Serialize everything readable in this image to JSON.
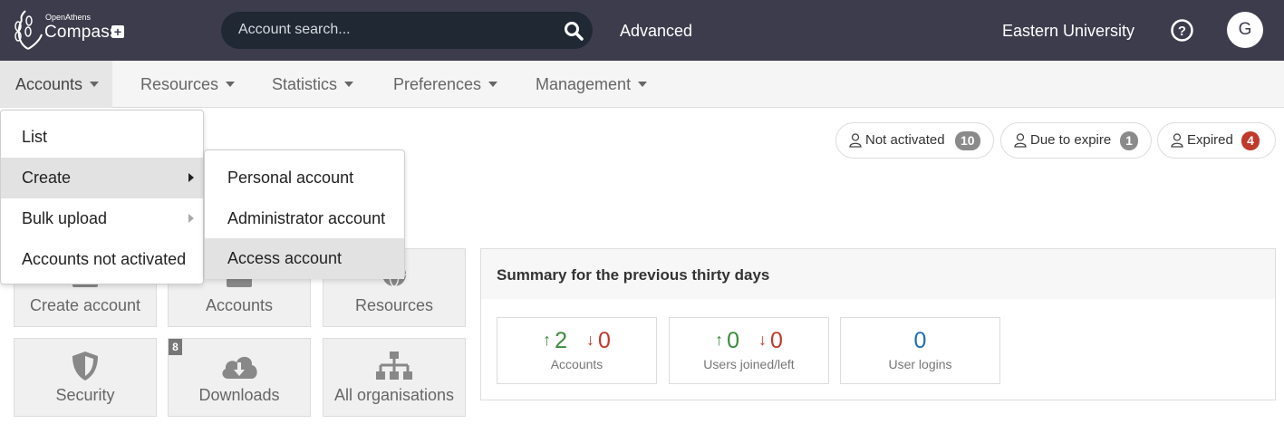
{
  "header": {
    "logo_small": "OpenAthens",
    "logo_big": "Compass",
    "search_placeholder": "Account search...",
    "advanced_label": "Advanced",
    "organisation": "Eastern University",
    "avatar_initial": "G"
  },
  "nav": {
    "items": [
      {
        "label": "Accounts",
        "active": true
      },
      {
        "label": "Resources"
      },
      {
        "label": "Statistics"
      },
      {
        "label": "Preferences"
      },
      {
        "label": "Management"
      }
    ]
  },
  "accounts_menu": {
    "items": [
      {
        "label": "List"
      },
      {
        "label": "Create",
        "highlighted": true,
        "has_submenu": true
      },
      {
        "label": "Bulk upload",
        "has_submenu": true
      },
      {
        "label": "Accounts not activated"
      }
    ]
  },
  "create_submenu": {
    "items": [
      {
        "label": "Personal account"
      },
      {
        "label": "Administrator account"
      },
      {
        "label": "Access account",
        "highlighted": true
      }
    ]
  },
  "status_pills": [
    {
      "label": "Not activated",
      "count": "10",
      "color": "#8a8a8a"
    },
    {
      "label": "Due to expire",
      "count": "1",
      "color": "#8a8a8a"
    },
    {
      "label": "Expired",
      "count": "4",
      "color": "#c0392b"
    }
  ],
  "tiles": [
    {
      "label": "Create account",
      "icon": "user-plus-icon"
    },
    {
      "label": "Accounts",
      "icon": "users-icon"
    },
    {
      "label": "Resources",
      "icon": "globe-icon"
    },
    {
      "label": "Security",
      "icon": "shield-icon"
    },
    {
      "label": "Downloads",
      "icon": "cloud-download-icon",
      "badge": "8"
    },
    {
      "label": "All organisations",
      "icon": "sitemap-icon"
    }
  ],
  "summary": {
    "title": "Summary for the previous thirty days",
    "stats": [
      {
        "up": "2",
        "down": "0",
        "label": "Accounts"
      },
      {
        "up": "0",
        "down": "0",
        "label": "Users joined/left"
      },
      {
        "value": "0",
        "label": "User logins"
      }
    ]
  },
  "colors": {
    "header_bg": "#3c3c4c",
    "up": "#3c8a3f",
    "down": "#c0392b",
    "logins": "#1f6fb2"
  }
}
